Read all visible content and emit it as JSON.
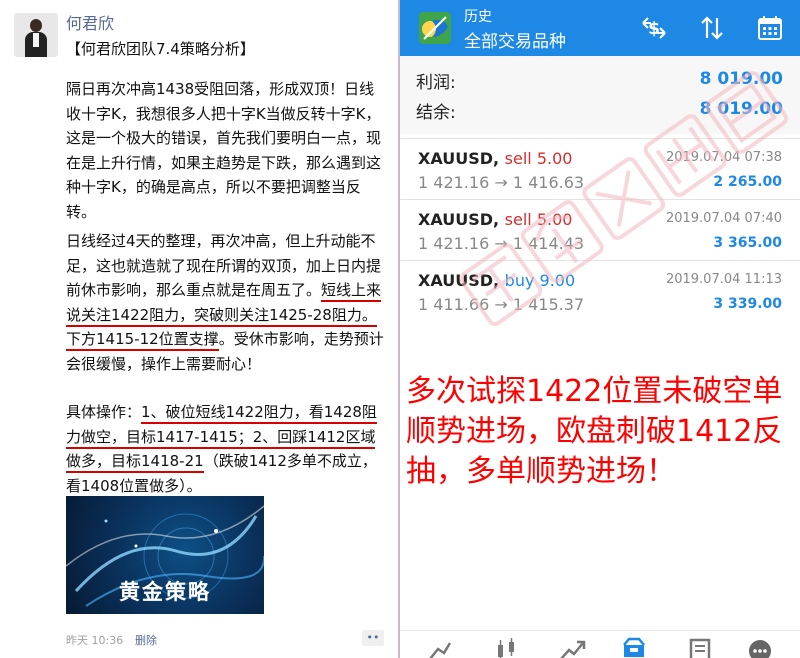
{
  "post": {
    "author": "何君欣",
    "title": "【何君欣团队7.4策略分析】",
    "para1": "隔日再次冲高1438受阻回落，形成双顶！日线收十字K，我想很多人把十字K当做反转十字K，这是一个极大的错误，首先我们要明白一点，现在是上升行情，如果主趋势是下跌，那么遇到这种十字K，的确是高点，所以不要把调整当反转。",
    "para2_a": "日线经过4天的整理，再次冲高，但上升动能不足，这也就造就了现在所谓的双顶，加上日内提前休市影响，那么重点就是在周五了。",
    "para2_ul": "短线上来说关注1422阻力，突破则关注1425-28阻力。下方1415-12位置支撑",
    "para2_b": "。受休市影响，走势预计会很缓慢，操作上需要耐心！",
    "para3_a": "具体操作：",
    "para3_ul": "1、破位短线1422阻力，看1428阻力做空，目标1417-1415；2、回踩1412区域做多，目标1418-21",
    "para3_b": "（跌破1412多单不成立，看1408位置做多）。",
    "banner_text": "黄金策略",
    "time": "昨天 10:36",
    "delete_label": "删除",
    "more_label": "••"
  },
  "app": {
    "title": "历史",
    "subtitle": "全部交易品种",
    "icons": [
      "exchange-dollar-icon",
      "sort-arrows-icon",
      "calendar-icon"
    ],
    "profit_label": "利润:",
    "profit_value": "8 019.00",
    "balance_label": "结余:",
    "balance_value": "8 019.00",
    "trades": [
      {
        "symbol": "XAUUSD,",
        "side": "sell 5.00",
        "date": "2019.07.04 07:38",
        "prices": "1 421.16 → 1 416.63",
        "profit": "2 265.00"
      },
      {
        "symbol": "XAUUSD,",
        "side": "sell 5.00",
        "date": "2019.07.04 07:40",
        "prices": "1 421.16 → 1 414.43",
        "profit": "3 365.00"
      },
      {
        "symbol": "XAUUSD,",
        "side": "buy 9.00",
        "date": "2019.07.04 11:13",
        "prices": "1 411.66 → 1 415.37",
        "profit": "3 339.00"
      }
    ],
    "annotation": "多次试探1422位置未破空单顺势进场，欧盘刺破1412反抽，多单顺势进场！",
    "watermark": "何君欣出品",
    "nav_icons": [
      "chart-edit-icon",
      "candlestick-icon",
      "trend-icon",
      "history-icon",
      "news-icon",
      "chat-icon"
    ]
  },
  "colors": {
    "accent": "#1e88e5",
    "sell": "#d32f2f",
    "annotation": "#ff0000",
    "link": "#576b95"
  }
}
